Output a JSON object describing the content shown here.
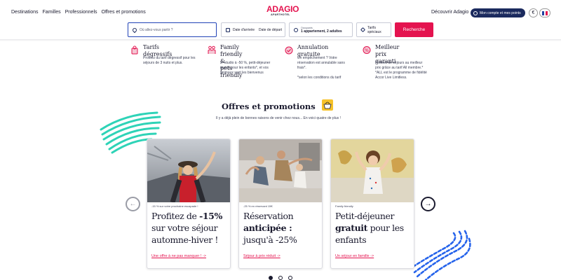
{
  "nav": {
    "links": [
      "Destinations",
      "Familles",
      "Professionnels",
      "Offres et promotions"
    ],
    "logo_main": "ADAGIO",
    "logo_sub": "APARTHOTEL",
    "discover": "Découvrir Adagio",
    "account": "Mon compte et mes points",
    "currency": "€"
  },
  "search": {
    "destination_placeholder": "Où allez-vous partir ?",
    "arrival": "Date d'arrivée",
    "departure": "Date de départ",
    "guests_label": "Occupants",
    "guests_value": "1 appartement, 2 adultes",
    "rates_line1": "Tarifs",
    "rates_line2": "spéciaux",
    "submit": "Recherche"
  },
  "features": [
    {
      "title": "Tarifs dégressifs",
      "text": [
        "Profitez du tarif dégressif pour les",
        "séjours de 3 nuits et plus."
      ]
    },
    {
      "title_lines": [
        "Family friendly &",
        "pets friendly"
      ],
      "text": [
        "2ᵉ studio à -50 %, petit-déjeuner",
        "gratuit pour les enfants*, et vos",
        "animaux sont les bienvenus"
      ]
    },
    {
      "title": "Annulation gratuite",
      "text": [
        "Un empêchement ? Votre",
        "réservation est annulable sans",
        "frais*.",
        "",
        "*selon les conditions du tarif"
      ]
    },
    {
      "title_lines": [
        "Meilleur prix",
        "garanti"
      ],
      "text": [
        "Profitez de séjours au meilleur",
        "prix grâce au tarif All membre.*",
        "*ALL est le programme de fidélité",
        "Accor Live Limitless."
      ]
    }
  ],
  "section": {
    "title": "Offres et promotions",
    "subtitle": "Il y a déjà plein de bonnes raisons de venir chez nous... En voici quatre de plus !"
  },
  "cards": [
    {
      "kicker": "-15 % sur votre prochaine escapade !",
      "t1": "Profitez de ",
      "b1": "-15%",
      "t2": " sur votre séjour automne-hiver !",
      "cta": "Une offre à ne pas manquer ! ->"
    },
    {
      "kicker": "-25 % en réservant 15€",
      "t1": "Réservation ",
      "b1": "anticipée :",
      "t2": " jusqu'à -25%",
      "cta": "Séjour à prix réduit ->"
    },
    {
      "kicker": "Family friendly",
      "t1": "Petit-déjeuner ",
      "b1": "gratuit",
      "t2": " pour les enfants",
      "cta": "Un séjour en famille ->"
    }
  ],
  "colors": {
    "brand": "#e4134f",
    "navy": "#1b2a5e",
    "teal": "#2ed3b7",
    "blue": "#2563eb"
  }
}
